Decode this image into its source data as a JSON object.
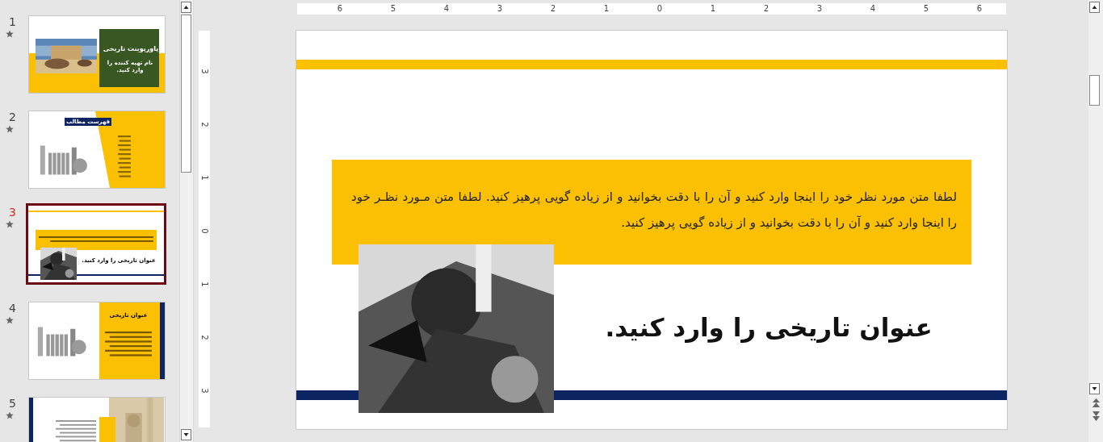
{
  "slide_panel": {
    "thumbnails": [
      {
        "number": "1",
        "selected": false,
        "kind": "title",
        "title": "پاورپوینت تاریخی",
        "subtitle": "نام تهیه کننده را وارد کنید."
      },
      {
        "number": "2",
        "selected": false,
        "kind": "toc",
        "title": "فهرست مطالب"
      },
      {
        "number": "3",
        "selected": true,
        "kind": "content",
        "title": "عنوان تاریخی را وارد کنید."
      },
      {
        "number": "4",
        "selected": false,
        "kind": "section",
        "title": "عنوان تاریخی"
      },
      {
        "number": "5",
        "selected": false,
        "kind": "side"
      }
    ]
  },
  "ruler": {
    "horizontal": [
      "6",
      "5",
      "4",
      "3",
      "2",
      "1",
      "0",
      "1",
      "2",
      "3",
      "4",
      "5",
      "6"
    ],
    "vertical": [
      "3",
      "2",
      "1",
      "0",
      "1",
      "2",
      "3"
    ]
  },
  "slide": {
    "body": "لطفا متن مورد نظر خود را اینجا وارد کنید و آن را با دقت بخوانید و از زیاده گویی پرهیز کنید. لطفا متن مـورد نظـر خود را اینجا وارد کنید و آن را با دقت بخوانید و از زیاده گویی پرهیز کنید.",
    "title": "عنوان تاریخی را وارد کنید."
  }
}
